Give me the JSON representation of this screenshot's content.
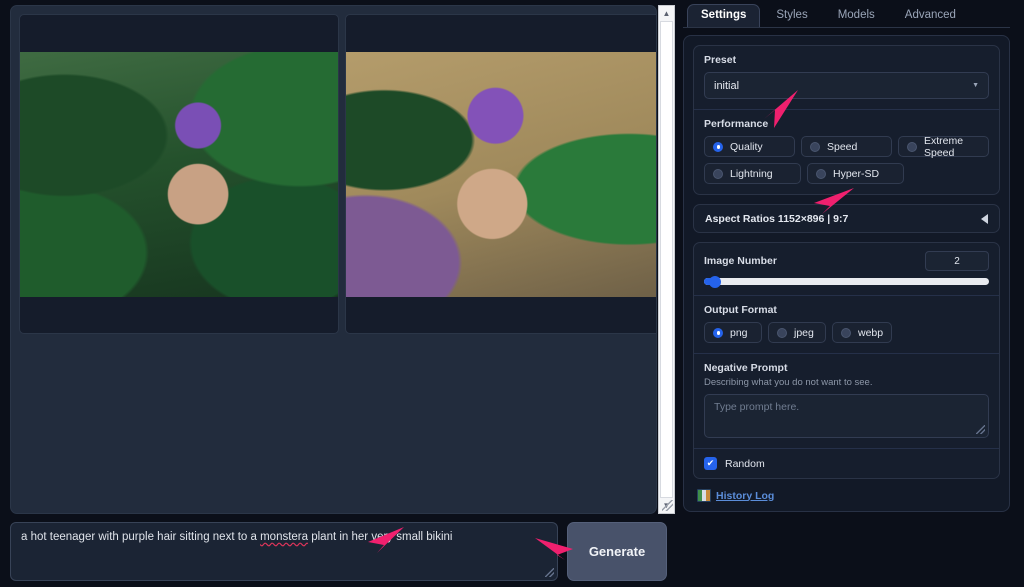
{
  "gallery": {
    "images": [
      {
        "name": "generated-image-1",
        "alt": "generated image 1 placeholder"
      },
      {
        "name": "generated-image-2",
        "alt": "generated image 2 placeholder"
      }
    ],
    "scrollbar": {
      "up": "▲",
      "down": "▼"
    }
  },
  "prompt": {
    "text_before": "a hot teenager with purple hair sitting next to a ",
    "misspelled_word": "monstera",
    "text_after": " plant in her very small bikini",
    "full_text": "a hot teenager with purple hair sitting next to a monstera plant in her very small bikini"
  },
  "generate": {
    "label": "Generate"
  },
  "tabs": [
    {
      "label": "Settings",
      "active": true
    },
    {
      "label": "Styles",
      "active": false
    },
    {
      "label": "Models",
      "active": false
    },
    {
      "label": "Advanced",
      "active": false
    }
  ],
  "preset": {
    "label": "Preset",
    "value": "initial",
    "caret": "▼"
  },
  "performance": {
    "label": "Performance",
    "options": [
      {
        "label": "Quality",
        "selected": true
      },
      {
        "label": "Speed",
        "selected": false
      },
      {
        "label": "Extreme Speed",
        "selected": false
      },
      {
        "label": "Lightning",
        "selected": false
      },
      {
        "label": "Hyper-SD",
        "selected": false
      }
    ]
  },
  "aspect_ratios": {
    "label": "Aspect Ratios 1152×896 | 9:7",
    "collapsed": true
  },
  "image_number": {
    "label": "Image Number",
    "value": "2",
    "percent": 4
  },
  "output_format": {
    "label": "Output Format",
    "options": [
      {
        "label": "png",
        "selected": true
      },
      {
        "label": "jpeg",
        "selected": false
      },
      {
        "label": "webp",
        "selected": false
      }
    ]
  },
  "negative_prompt": {
    "label": "Negative Prompt",
    "description": "Describing what you do not want to see.",
    "placeholder": "Type prompt here.",
    "value": ""
  },
  "random": {
    "label": "Random",
    "checked": true,
    "mark": "✔"
  },
  "history_log": {
    "label": "History Log"
  },
  "colors": {
    "accent_blue": "#2563eb",
    "annotation_pink": "#f0206e",
    "panel_bg": "#121927",
    "app_bg": "#0b0f19"
  }
}
